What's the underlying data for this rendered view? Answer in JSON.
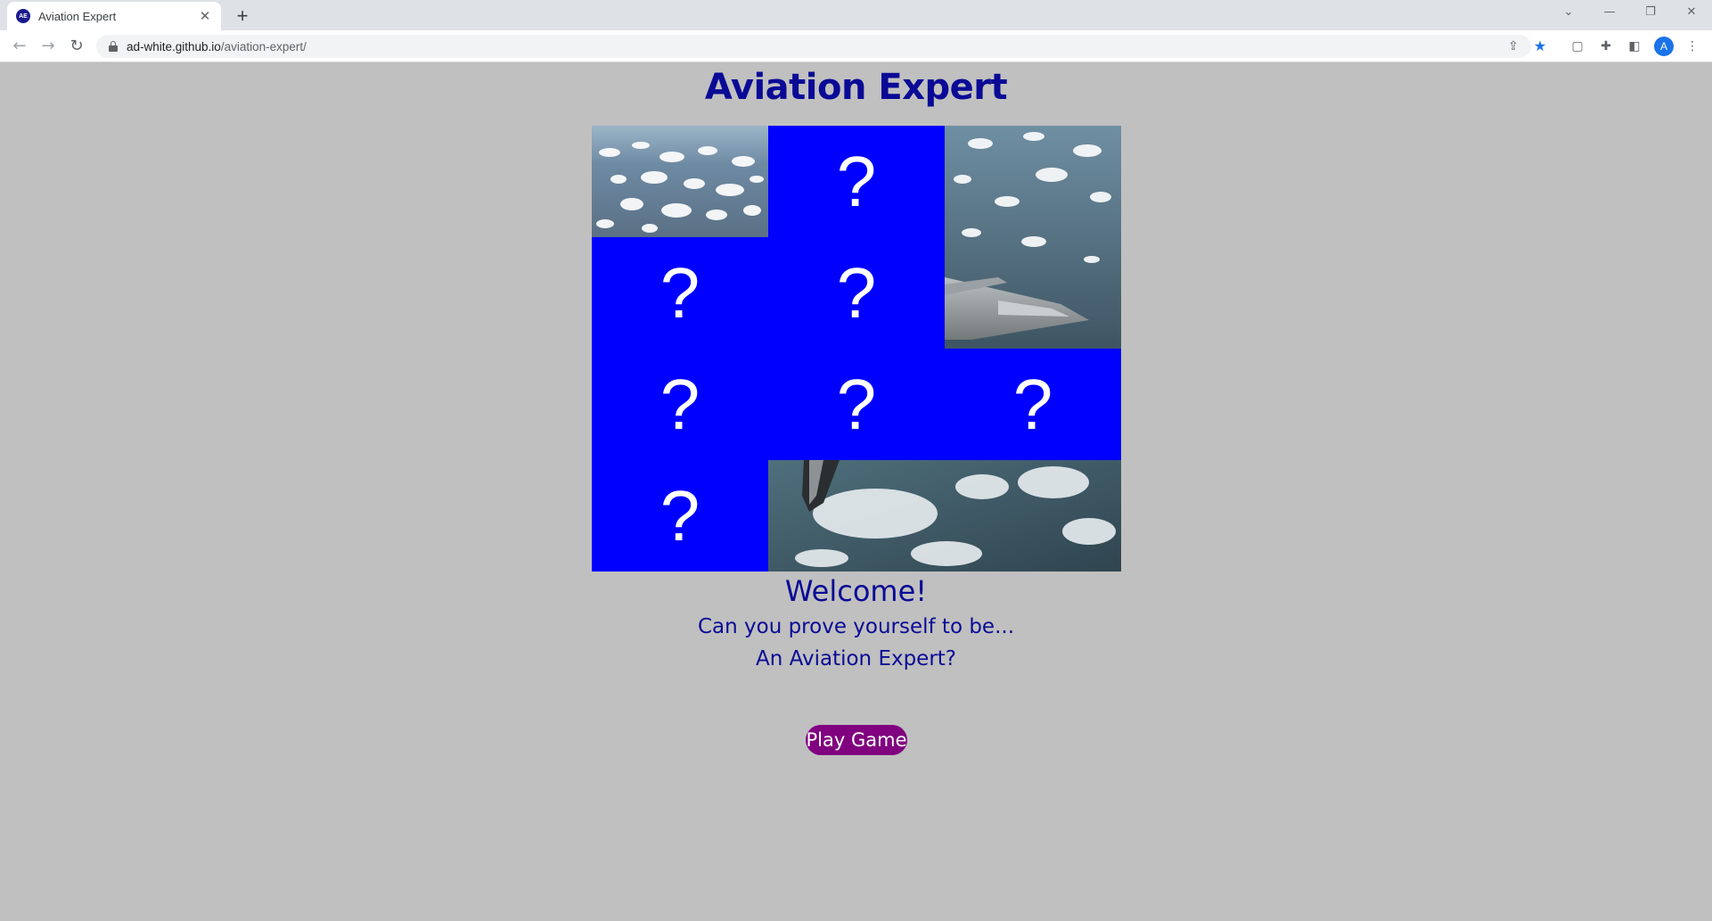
{
  "browser": {
    "tab_title": "Aviation Expert",
    "favicon_text": "AE",
    "tab_close": "✕",
    "new_tab": "+",
    "url_host": "ad-white.github.io",
    "url_path": "/aviation-expert/",
    "profile_initial": "A",
    "window_controls": [
      "⌄",
      "—",
      "❐",
      "✕"
    ]
  },
  "page": {
    "title": "Aviation Expert",
    "welcome": "Welcome!",
    "tagline_line1": "Can you prove yourself to be...",
    "tagline_line2": "An Aviation Expert?",
    "play_button": "Play Game"
  },
  "cards": {
    "hidden_symbol": "?",
    "hidden_color": "#0000ff",
    "tiles": [
      {
        "state": "revealed",
        "image": "clouds-from-above"
      },
      {
        "state": "hidden"
      },
      {
        "state": "revealed",
        "image": "aircraft-wing-over-clouds"
      },
      {
        "state": "hidden"
      },
      {
        "state": "hidden"
      },
      {
        "state": "hidden"
      },
      {
        "state": "hidden"
      },
      {
        "state": "hidden"
      },
      {
        "state": "hidden"
      },
      {
        "state": "hidden"
      },
      {
        "state": "revealed",
        "image": "aircraft-nose-over-clouds"
      }
    ]
  },
  "colors": {
    "page_background": "#c0c0c0",
    "heading_text": "#0a0a96",
    "button_background": "#800080",
    "button_text": "#ffffff"
  }
}
